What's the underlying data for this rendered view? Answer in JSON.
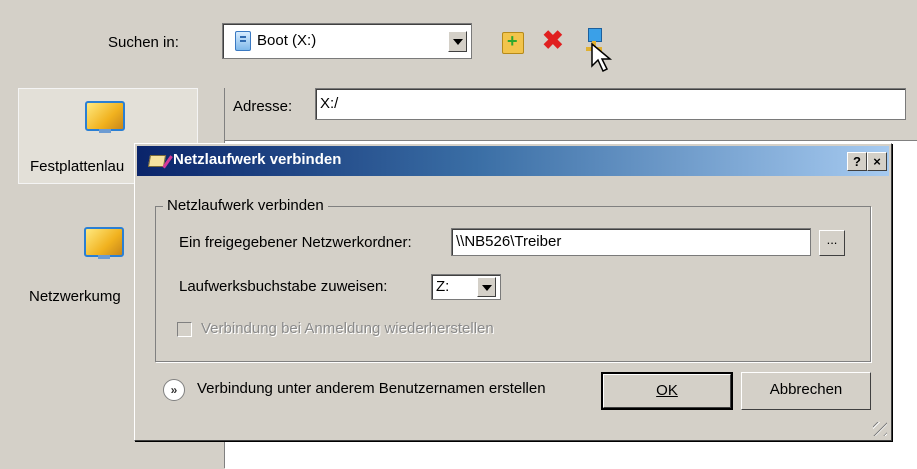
{
  "background_dialog": {
    "search_label": "Suchen in:",
    "search_value": "Boot (X:)",
    "address_label": "Adresse:",
    "address_value": "X:/",
    "places": [
      {
        "label": "Festplattenlau"
      },
      {
        "label": "Netzwerkumg"
      }
    ],
    "toolbar_icons": [
      "new-folder-icon",
      "delete-icon",
      "map-network-drive-icon"
    ]
  },
  "dialog": {
    "title": "Netzlaufwerk verbinden",
    "help_btn": "?",
    "close_btn": "×",
    "group_title": "Netzlaufwerk verbinden",
    "folder_label": "Ein freigegebener Netzwerkordner:",
    "folder_value": "\\\\NB526\\Treiber",
    "browse_btn": "...",
    "letter_label": "Laufwerksbuchstabe zuweisen:",
    "letter_value": "Z:",
    "reconnect_label": "Verbindung bei Anmeldung wiederherstellen",
    "other_user_label": "Verbindung unter anderem Benutzernamen erstellen",
    "ok_label": "OK",
    "cancel_label": "Abbrechen"
  }
}
